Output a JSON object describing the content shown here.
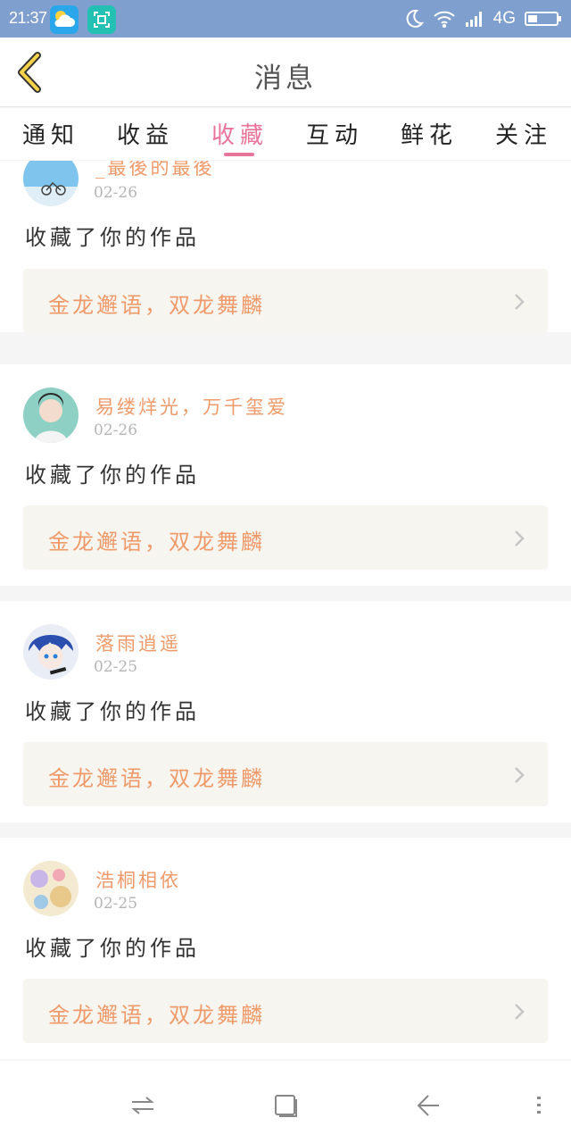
{
  "status_bar": {
    "time": "21:37",
    "network": "4G",
    "icons": [
      "weather-icon",
      "scan-icon",
      "moon-icon",
      "wifi-icon",
      "signal-icon",
      "battery-icon"
    ]
  },
  "header": {
    "title": "消息",
    "back_icon": "chevron-left-icon"
  },
  "tabs": {
    "items": [
      {
        "label": "通知"
      },
      {
        "label": "收益"
      },
      {
        "label": "收藏"
      },
      {
        "label": "互动"
      },
      {
        "label": "鲜花"
      },
      {
        "label": "关注"
      }
    ],
    "active_index": 2
  },
  "notifications": [
    {
      "username": "_最後的最後",
      "date": "02-26",
      "action": "收藏了你的作品",
      "work_title": "金龙邂语，双龙舞麟"
    },
    {
      "username": "易缕烊光，万千玺爱",
      "date": "02-26",
      "action": "收藏了你的作品",
      "work_title": "金龙邂语，双龙舞麟"
    },
    {
      "username": "落雨逍遥",
      "date": "02-25",
      "action": "收藏了你的作品",
      "work_title": "金龙邂语，双龙舞麟"
    },
    {
      "username": "浩桐相依",
      "date": "02-25",
      "action": "收藏了你的作品",
      "work_title": "金龙邂语，双龙舞麟"
    }
  ],
  "nav_bar": {
    "icons": [
      "switch-icon",
      "home-square-icon",
      "back-arrow-icon",
      "menu-dots-icon"
    ]
  },
  "colors": {
    "accent": "#e8749a",
    "username": "#ef9a6a",
    "status_bar": "#7f9fcf",
    "work_card_bg": "#f6f5ef"
  }
}
